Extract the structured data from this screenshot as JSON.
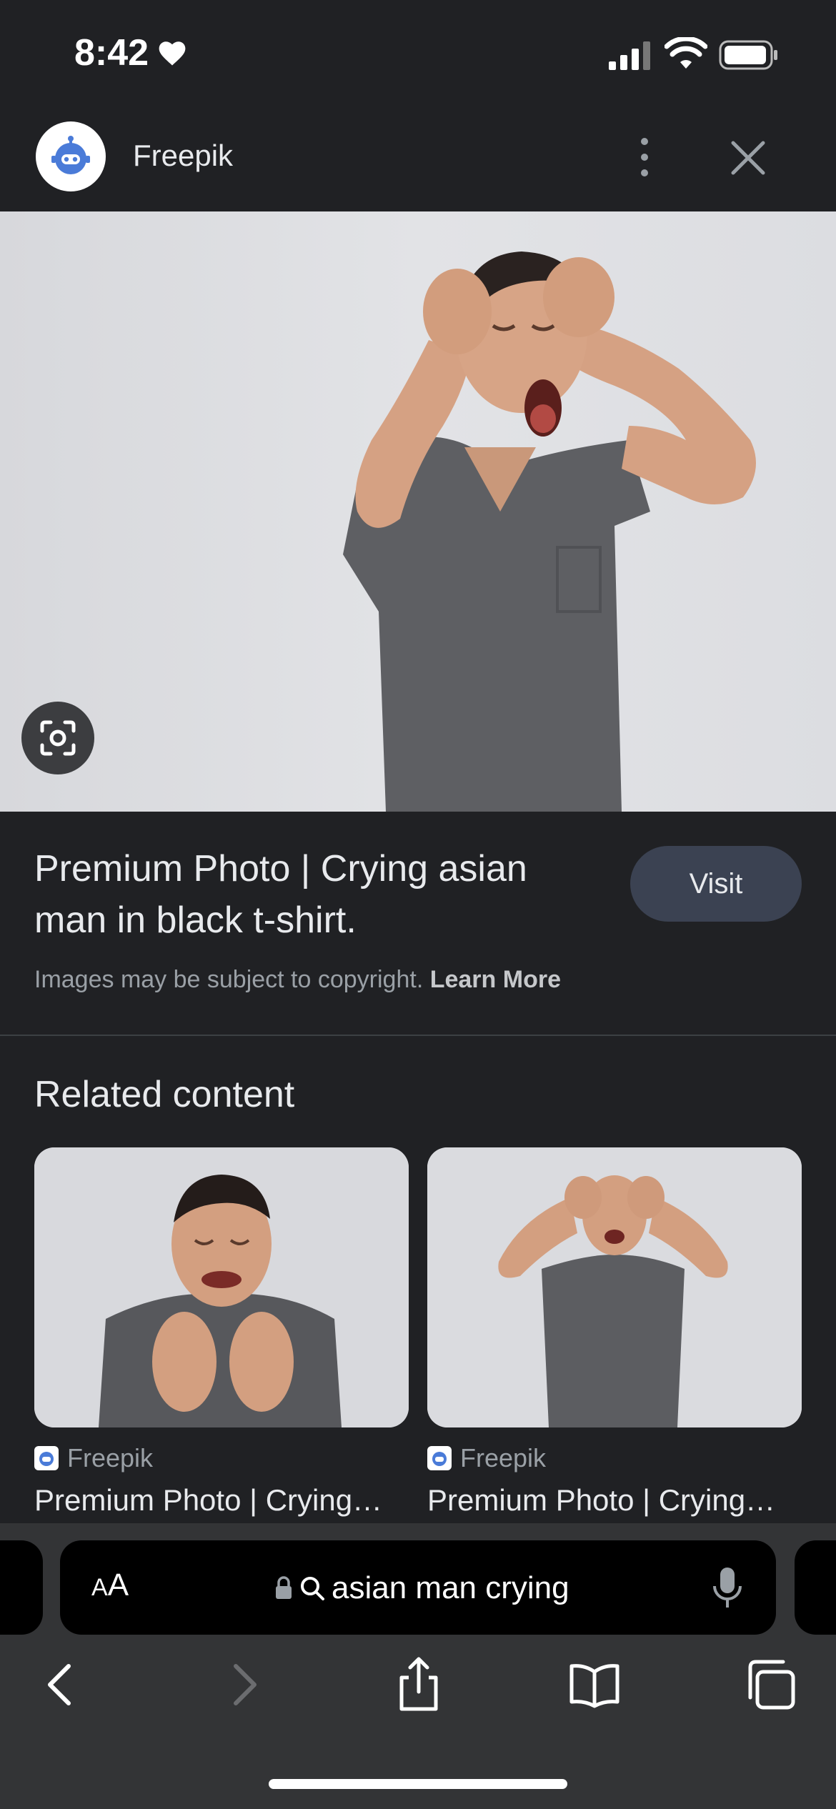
{
  "status_bar": {
    "time": "8:42"
  },
  "header": {
    "site_name": "Freepik"
  },
  "info": {
    "title": "Premium Photo | Crying asian man in black t-shirt.",
    "visit_label": "Visit",
    "copyright_text": "Images may be subject to copyright.",
    "learn_more": "Learn More"
  },
  "related": {
    "heading": "Related content",
    "items": [
      {
        "source": "Freepik",
        "title": "Premium Photo | Crying…"
      },
      {
        "source": "Freepik",
        "title": "Premium Photo | Crying…"
      }
    ]
  },
  "address_bar": {
    "aa_big": "A",
    "aa_small": "A",
    "query": "asian man crying"
  },
  "colors": {
    "background": "#202124",
    "toolbar": "#333436",
    "visit_button": "#3b4252",
    "accent_blue": "#4a7bd8"
  }
}
